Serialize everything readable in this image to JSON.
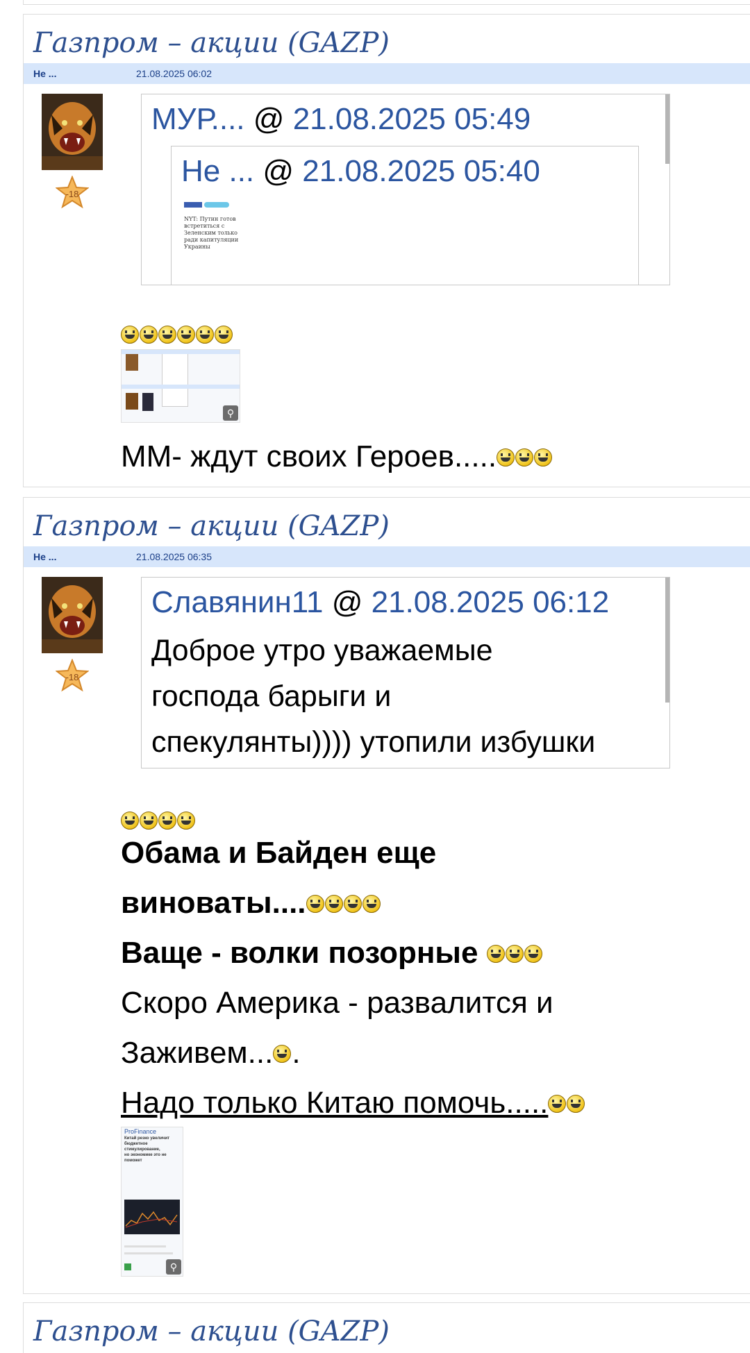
{
  "posts": [
    {
      "title": "Газпром – акции (GAZP)",
      "author": "Не ...",
      "date": "21.08.2025 06:02",
      "rank": "-18",
      "quote": {
        "author": "МУР....",
        "at": "@",
        "date": "21.08.2025 05:49",
        "inner": {
          "author": "Не ...",
          "at": "@",
          "date": "21.08.2025 05:40",
          "image_text": [
            "NYT: Путин готов",
            "встретиться с",
            "Зеленским только",
            "ради капитуляции",
            "Украины"
          ]
        }
      },
      "body_line": "ММ- ждут своих Героев....."
    },
    {
      "title": "Газпром – акции (GAZP)",
      "author": "Не ...",
      "date": "21.08.2025 06:35",
      "rank": "-18",
      "quote": {
        "author": "Славянин11",
        "at": "@",
        "date": "21.08.2025 06:12",
        "text_lines": [
          "Доброе утро уважаемые",
          "господа барыги и",
          "спекулянты)))) утопили избушки"
        ]
      },
      "lines": [
        "Обама и Байден еще",
        "виноваты....",
        "Ваще - волки позорные",
        "Скоро Америка - развалится и",
        "Заживем...",
        ".",
        "Надо только Китаю помочь....."
      ],
      "image_title": "ProFinance",
      "image_headline": [
        "Китай резко увеличит",
        "бюджетное стимулирование,",
        "но экономике это не поможет"
      ]
    },
    {
      "title": "Газпром – акции (GAZP)"
    }
  ],
  "icons": {
    "zoom": "magnifier-icon",
    "smile": "smiley-icon",
    "rank": "star-rank-icon",
    "avatar": "tiger-avatar"
  }
}
